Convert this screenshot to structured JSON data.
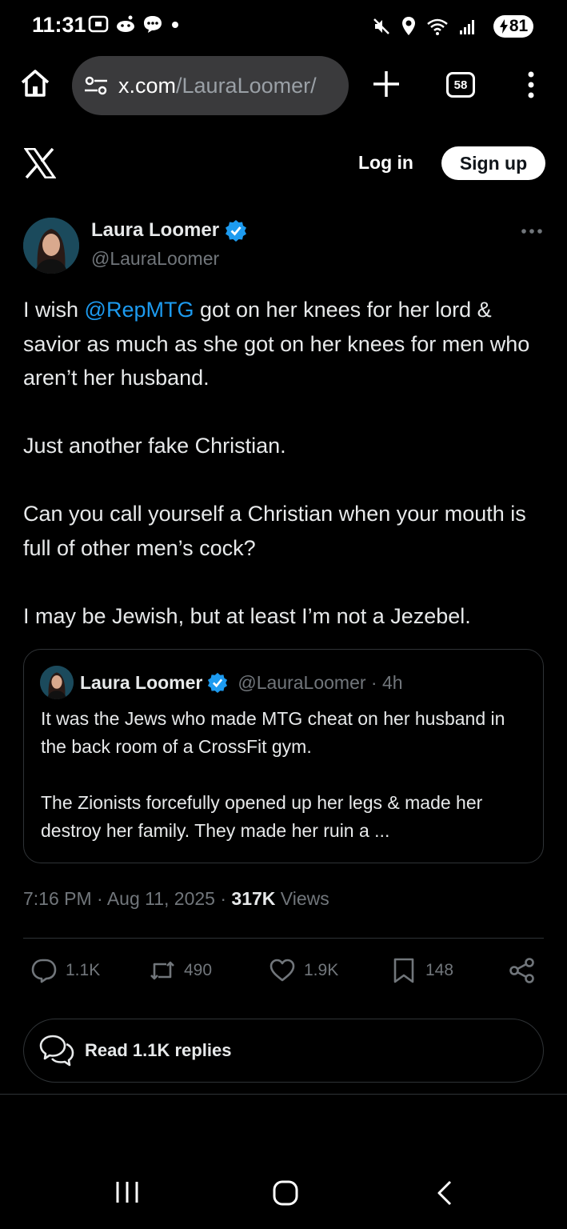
{
  "status_bar": {
    "time": "11:31",
    "battery": "81"
  },
  "browser": {
    "url_host": "x.com",
    "url_path": "/LauraLoomer/",
    "tab_count": "58"
  },
  "header": {
    "login_label": "Log in",
    "signup_label": "Sign up"
  },
  "tweet": {
    "author_name": "Laura Loomer",
    "author_handle": "@LauraLoomer",
    "text": {
      "p1_prefix": "I wish ",
      "p1_mention": "@RepMTG",
      "p1_suffix": " got on her knees for her lord & savior as much as she got on her knees for men who aren’t her husband.",
      "p2": "Just another fake Christian.",
      "p3": "Can you call yourself a Christian when your mouth is full of other men’s cock?",
      "p4": "I may be Jewish, but at least I’m not a Jezebel."
    },
    "quote": {
      "author_name": "Laura Loomer",
      "author_meta": "@LauraLoomer · 4h",
      "p1": "It was the Jews who made MTG cheat on her husband in the back room of a CrossFit gym.",
      "p2": "The Zionists forcefully opened up her legs & made her destroy her family. They made her ruin a ..."
    },
    "time": "7:16 PM · Aug 11, 2025 · ",
    "views_count": "317K",
    "views_label": " Views",
    "stats": {
      "replies": "1.1K",
      "reposts": "490",
      "likes": "1.9K",
      "bookmarks": "148"
    },
    "read_replies_label": "Read 1.1K replies"
  },
  "colors": {
    "background": "#000000",
    "text": "#e7e9ea",
    "secondary": "#71767b",
    "accent": "#1d9bf0",
    "border": "#2f3336"
  }
}
